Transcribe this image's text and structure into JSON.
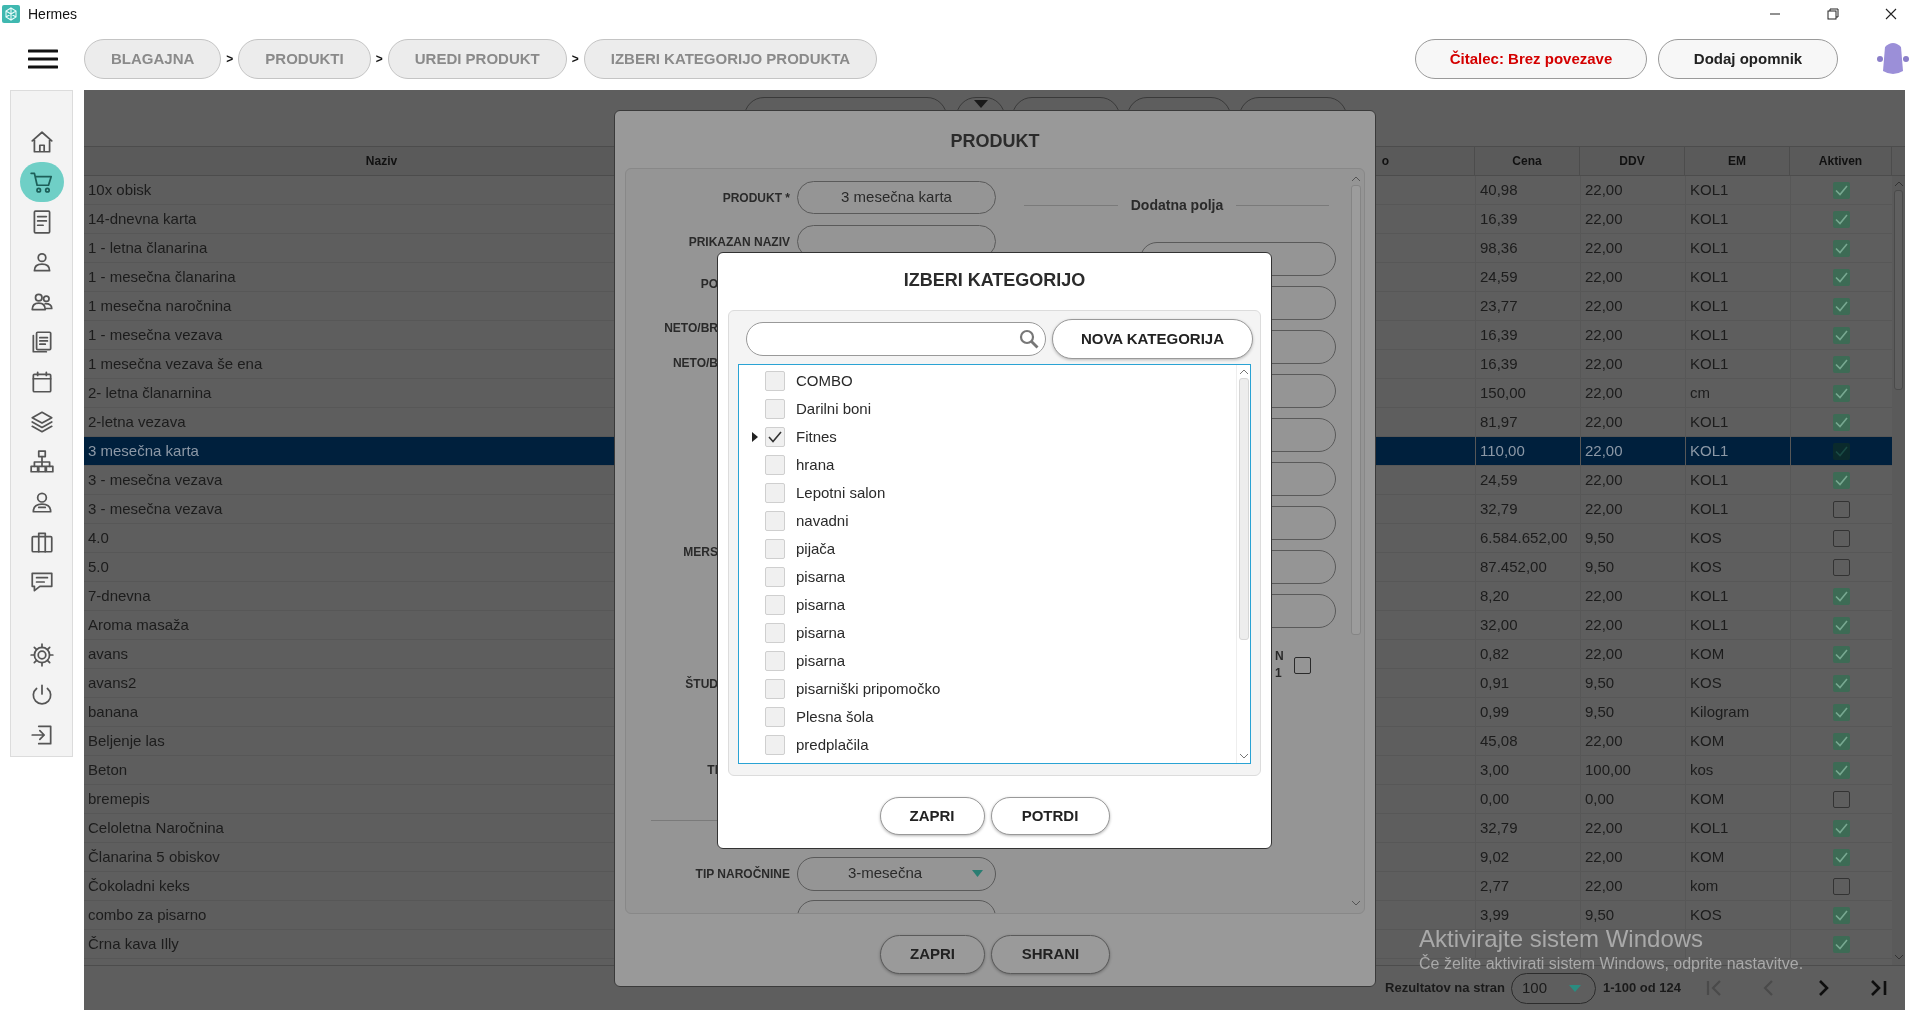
{
  "window": {
    "title": "Hermes"
  },
  "breadcrumbs": [
    "BLAGAJNA",
    "PRODUKTI",
    "UREDI PRODUKT",
    "IZBERI KATEGORIJO PRODUKTA"
  ],
  "breadcrumb_separators": [
    ">",
    ">",
    ">"
  ],
  "reader_button": "Čitalec: Brez povezave",
  "reminder_button": "Dodaj opomnik",
  "sidebar": {
    "items": [
      {
        "selected": false
      },
      {
        "selected": true
      },
      {
        "selected": false
      },
      {
        "selected": false
      },
      {
        "selected": false
      },
      {
        "selected": false
      },
      {
        "selected": false
      },
      {
        "selected": false
      },
      {
        "selected": false
      },
      {
        "selected": false
      },
      {
        "selected": false
      },
      {
        "selected": false
      },
      {
        "selected": false
      },
      {
        "selected": false
      },
      {
        "selected": false
      }
    ]
  },
  "table": {
    "columns": [
      "Naziv",
      "o",
      "Cena",
      "DDV",
      "EM",
      "Aktiven"
    ],
    "rows": [
      {
        "naziv": "10x obisk",
        "cena": "40,98",
        "ddv": "22,00",
        "em": "KOL1",
        "aktiven": true,
        "selected": false
      },
      {
        "naziv": "14-dnevna karta",
        "cena": "16,39",
        "ddv": "22,00",
        "em": "KOL1",
        "aktiven": true,
        "selected": false
      },
      {
        "naziv": "1 - letna članarina",
        "cena": "98,36",
        "ddv": "22,00",
        "em": "KOL1",
        "aktiven": true,
        "selected": false
      },
      {
        "naziv": "1 - mesečna članarina",
        "cena": "24,59",
        "ddv": "22,00",
        "em": "KOL1",
        "aktiven": true,
        "selected": false
      },
      {
        "naziv": "1 mesečna naročnina",
        "cena": "23,77",
        "ddv": "22,00",
        "em": "KOL1",
        "aktiven": true,
        "selected": false
      },
      {
        "naziv": "1 - mesečna vezava",
        "cena": "16,39",
        "ddv": "22,00",
        "em": "KOL1",
        "aktiven": true,
        "selected": false
      },
      {
        "naziv": "1 mesečna vezava še ena",
        "cena": "16,39",
        "ddv": "22,00",
        "em": "KOL1",
        "aktiven": true,
        "selected": false
      },
      {
        "naziv": "2- letna članarnina",
        "cena": "150,00",
        "ddv": "22,00",
        "em": "cm",
        "aktiven": true,
        "selected": false
      },
      {
        "naziv": "2-letna vezava",
        "cena": "81,97",
        "ddv": "22,00",
        "em": "KOL1",
        "aktiven": true,
        "selected": false
      },
      {
        "naziv": "3 mesečna karta",
        "cena": "110,00",
        "ddv": "22,00",
        "em": "KOL1",
        "aktiven": true,
        "selected": true
      },
      {
        "naziv": "3 - mesečna vezava",
        "cena": "24,59",
        "ddv": "22,00",
        "em": "KOL1",
        "aktiven": true,
        "selected": false
      },
      {
        "naziv": "3 - mesečna vezava",
        "cena": "32,79",
        "ddv": "22,00",
        "em": "KOL1",
        "aktiven": false,
        "selected": false
      },
      {
        "naziv": "4.0",
        "cena": "6.584.652,00",
        "ddv": "9,50",
        "em": "KOS",
        "aktiven": false,
        "selected": false
      },
      {
        "naziv": "5.0",
        "cena": "87.452,00",
        "ddv": "9,50",
        "em": "KOS",
        "aktiven": false,
        "selected": false
      },
      {
        "naziv": "7-dnevna",
        "cena": "8,20",
        "ddv": "22,00",
        "em": "KOL1",
        "aktiven": true,
        "selected": false
      },
      {
        "naziv": "Aroma masaža",
        "cena": "32,00",
        "ddv": "22,00",
        "em": "KOL1",
        "aktiven": true,
        "selected": false
      },
      {
        "naziv": "avans",
        "cena": "0,82",
        "ddv": "22,00",
        "em": "KOM",
        "aktiven": true,
        "selected": false
      },
      {
        "naziv": "avans2",
        "cena": "0,91",
        "ddv": "9,50",
        "em": "KOS",
        "aktiven": true,
        "selected": false
      },
      {
        "naziv": "banana",
        "cena": "0,99",
        "ddv": "9,50",
        "em": "Kilogram",
        "aktiven": true,
        "selected": false
      },
      {
        "naziv": "Beljenje las",
        "cena": "45,08",
        "ddv": "22,00",
        "em": "KOM",
        "aktiven": true,
        "selected": false
      },
      {
        "naziv": "Beton",
        "cena": "3,00",
        "ddv": "100,00",
        "em": "kos",
        "aktiven": true,
        "selected": false
      },
      {
        "naziv": "bremepis",
        "cena": "0,00",
        "ddv": "0,00",
        "em": "KOM",
        "aktiven": false,
        "selected": false
      },
      {
        "naziv": "Celoletna Naročnina",
        "cena": "32,79",
        "ddv": "22,00",
        "em": "KOL1",
        "aktiven": true,
        "selected": false
      },
      {
        "naziv": "Članarina 5 obiskov",
        "cena": "9,02",
        "ddv": "22,00",
        "em": "KOM",
        "aktiven": true,
        "selected": false
      },
      {
        "naziv": "Čokoladni keks",
        "cena": "2,77",
        "ddv": "22,00",
        "em": "kom",
        "aktiven": false,
        "selected": false
      },
      {
        "naziv": "combo za pisarno",
        "cena": "3,99",
        "ddv": "9,50",
        "em": "KOS",
        "aktiven": true,
        "selected": false
      },
      {
        "naziv": "Črna kava Illy",
        "aktiven": true,
        "selected": false
      }
    ]
  },
  "pagination": {
    "label": "Rezultatov na stran",
    "page_size": "100",
    "range": "1-100 od 124",
    "buttons": [
      {
        "disabled": true
      },
      {
        "disabled": true
      },
      {
        "disabled": false
      },
      {
        "disabled": false
      }
    ]
  },
  "product_dialog": {
    "title": "PRODUKT",
    "fields": [
      {
        "label": "PRODUKT *",
        "kind": "text",
        "value": "3 mesečna karta"
      },
      {
        "label": "PRIKAZAN NAZIV",
        "kind": "text"
      },
      {
        "label": "PO",
        "kind": "partial"
      },
      {
        "label": "NETO/BR",
        "kind": "partial"
      },
      {
        "label": "NETO/B",
        "kind": "partial"
      },
      {
        "label": "MERS",
        "kind": "partial"
      },
      {
        "label": "ŠTUD",
        "kind": "partial"
      },
      {
        "label": "TI",
        "kind": "partial"
      },
      {
        "label": "TIP NAROČNINE",
        "kind": "select",
        "value": "3-mesečna"
      }
    ],
    "extra_title": "Dodatna polja",
    "extra_labels": [
      "N",
      "1"
    ],
    "extra_checkbox": {
      "checked": false
    },
    "buttons": [
      "ZAPRI",
      "SHRANI"
    ]
  },
  "category_dialog": {
    "title": "IZBERI KATEGORIJO",
    "new_button": "NOVA KATEGORIJA",
    "items": [
      {
        "label": "COMBO",
        "checked": false,
        "expandable": false
      },
      {
        "label": "Darilni boni",
        "checked": false,
        "expandable": false
      },
      {
        "label": "Fitnes",
        "checked": true,
        "expandable": true
      },
      {
        "label": "hrana",
        "checked": false,
        "expandable": false
      },
      {
        "label": "Lepotni salon",
        "checked": false,
        "expandable": false
      },
      {
        "label": "navadni",
        "checked": false,
        "expandable": false
      },
      {
        "label": "pijača",
        "checked": false,
        "expandable": false
      },
      {
        "label": "pisarna",
        "checked": false,
        "expandable": false
      },
      {
        "label": "pisarna",
        "checked": false,
        "expandable": false
      },
      {
        "label": "pisarna",
        "checked": false,
        "expandable": false
      },
      {
        "label": "pisarna",
        "checked": false,
        "expandable": false
      },
      {
        "label": "pisarniški pripomočko",
        "checked": false,
        "expandable": false
      },
      {
        "label": "Plesna šola",
        "checked": false,
        "expandable": false
      },
      {
        "label": "predplačila",
        "checked": false,
        "expandable": false
      }
    ],
    "buttons": [
      "ZAPRI",
      "POTRDI"
    ]
  },
  "windows_notice": [
    "Aktivirajte sistem Windows",
    "Če želite aktivirati sistem Windows, odprite nastavitve."
  ]
}
